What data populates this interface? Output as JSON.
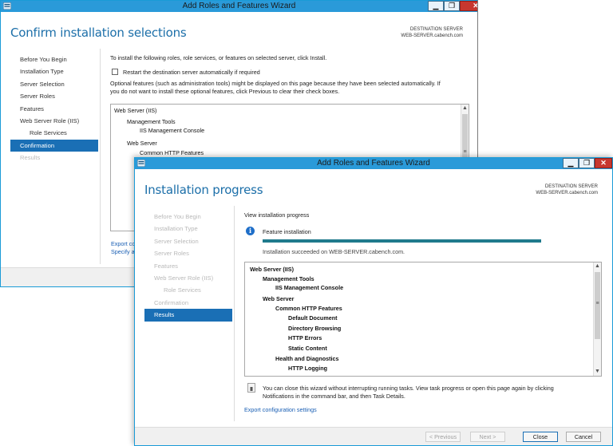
{
  "back_window": {
    "title": "Add Roles and Features Wizard",
    "heading": "Confirm installation selections",
    "destination_label": "DESTINATION SERVER",
    "destination_server": "WEB-SERVER.cabench.com",
    "nav": [
      {
        "label": "Before You Begin",
        "state": "normal"
      },
      {
        "label": "Installation Type",
        "state": "normal"
      },
      {
        "label": "Server Selection",
        "state": "normal"
      },
      {
        "label": "Server Roles",
        "state": "normal"
      },
      {
        "label": "Features",
        "state": "normal"
      },
      {
        "label": "Web Server Role (IIS)",
        "state": "normal"
      },
      {
        "label": "Role Services",
        "state": "normal",
        "sub": true
      },
      {
        "label": "Confirmation",
        "state": "active"
      },
      {
        "label": "Results",
        "state": "dim"
      }
    ],
    "intro": "To install the following roles, role services, or features on selected server, click Install.",
    "restart_checkbox_label": "Restart the destination server automatically if required",
    "optional_text_1": "Optional features (such as administration tools) might be displayed on this page because they have been selected automatically. If",
    "optional_text_2": "you do not want to install these optional features, click Previous to clear their check boxes.",
    "tree": [
      {
        "label": "Web Server (IIS)",
        "level": 0
      },
      {
        "label": "Management Tools",
        "level": 1
      },
      {
        "label": "IIS Management Console",
        "level": 2
      },
      {
        "label": "Web Server",
        "level": 1
      },
      {
        "label": "Common HTTP Features",
        "level": 2
      }
    ],
    "export_link_partial": "Export cc",
    "specify_link_partial": "Specify a"
  },
  "front_window": {
    "title": "Add Roles and Features Wizard",
    "heading": "Installation progress",
    "destination_label": "DESTINATION SERVER",
    "destination_server": "WEB-SERVER.cabench.com",
    "nav": [
      {
        "label": "Before You Begin",
        "state": "dim"
      },
      {
        "label": "Installation Type",
        "state": "dim"
      },
      {
        "label": "Server Selection",
        "state": "dim"
      },
      {
        "label": "Server Roles",
        "state": "dim"
      },
      {
        "label": "Features",
        "state": "dim"
      },
      {
        "label": "Web Server Role (IIS)",
        "state": "dim"
      },
      {
        "label": "Role Services",
        "state": "dim",
        "sub": true
      },
      {
        "label": "Confirmation",
        "state": "dim"
      },
      {
        "label": "Results",
        "state": "active"
      }
    ],
    "view_progress": "View installation progress",
    "feature_installation": "Feature installation",
    "progress_percent": 100,
    "status": "Installation succeeded on WEB-SERVER.cabench.com.",
    "tree": [
      {
        "label": "Web Server (IIS)",
        "level": 0
      },
      {
        "label": "Management Tools",
        "level": 1
      },
      {
        "label": "IIS Management Console",
        "level": 2
      },
      {
        "label": "Web Server",
        "level": 1
      },
      {
        "label": "Common HTTP Features",
        "level": 2
      },
      {
        "label": "Default Document",
        "level": 3
      },
      {
        "label": "Directory Browsing",
        "level": 3
      },
      {
        "label": "HTTP Errors",
        "level": 3
      },
      {
        "label": "Static Content",
        "level": 3
      },
      {
        "label": "Health and Diagnostics",
        "level": 2
      },
      {
        "label": "HTTP Logging",
        "level": 3
      }
    ],
    "note_line_1": "You can close this wizard without interrupting running tasks. View task progress or open this page again by clicking",
    "note_line_2": "Notifications in the command bar, and then Task Details.",
    "export_link": "Export configuration settings",
    "buttons": {
      "previous": "< Previous",
      "next": "Next >",
      "close": "Close",
      "cancel": "Cancel"
    }
  },
  "colors": {
    "titlebar": "#2a9ad9",
    "heading": "#1c6fa9",
    "nav_active": "#1a6fb5",
    "progress": "#1f7a8c",
    "link": "#1a5fb4"
  }
}
